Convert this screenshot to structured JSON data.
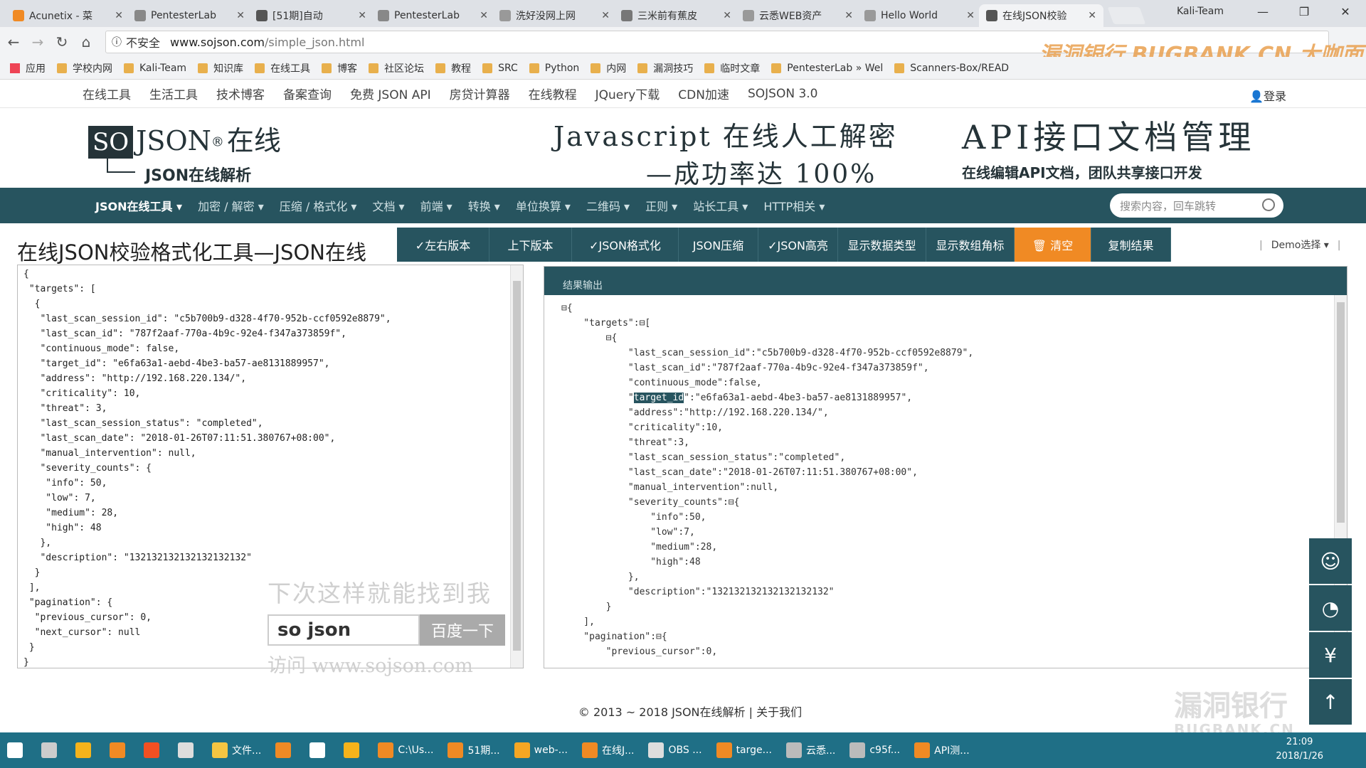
{
  "browser": {
    "tabs": [
      {
        "title": "Acunetix - 菜",
        "color": "#f08a24"
      },
      {
        "title": "PentesterLab",
        "color": "#888888"
      },
      {
        "title": "[51期]自动",
        "color": "#555555"
      },
      {
        "title": "PentesterLab",
        "color": "#888888"
      },
      {
        "title": "洗好没网上网",
        "color": "#999999"
      },
      {
        "title": "三米前有蕉皮",
        "color": "#777777"
      },
      {
        "title": "云悉WEB资产",
        "color": "#999999"
      },
      {
        "title": "Hello World",
        "color": "#999999"
      },
      {
        "title": "在线JSON校验",
        "color": "#555555"
      }
    ],
    "profile": "Kali-Team",
    "address": {
      "security": "不安全",
      "url_host": "www.sojson.com",
      "url_path": "/simple_json.html"
    },
    "bookmarks": [
      "应用",
      "学校内网",
      "Kali-Team",
      "知识库",
      "在线工具",
      "博客",
      "社区论坛",
      "教程",
      "SRC",
      "Python",
      "内网",
      "漏洞技巧",
      "临时文章",
      "PentesterLab » Wel",
      "Scanners-Box/READ"
    ],
    "overlay_watermark": "漏洞银行 BUGBANK.CN 大咖面对面"
  },
  "site": {
    "topnav": [
      "在线工具",
      "生活工具",
      "技术博客",
      "备案查询",
      "免费 JSON API",
      "房贷计算器",
      "在线教程",
      "JQuery下载",
      "CDN加速",
      "SOJSON 3.0"
    ],
    "login": "登录",
    "logo_so": "SO",
    "logo_json": "JSON",
    "logo_reg": "®",
    "logo_online": "在线",
    "logo_sub": "JSON在线解析",
    "ad1_line1": "Javascript 在线人工解密",
    "ad1_line2": "—成功率达 100%",
    "ad2_line1": "API接口文档管理",
    "ad2_line2": "在线编辑API文档，团队共享接口开发",
    "mainnav": [
      "JSON在线工具 ▾",
      "加密 / 解密 ▾",
      "压缩 / 格式化 ▾",
      "文档 ▾",
      "前端 ▾",
      "转换 ▾",
      "单位换算 ▾",
      "二维码 ▾",
      "正则 ▾",
      "站长工具 ▾",
      "HTTP相关 ▾"
    ],
    "search_placeholder": "搜索内容，回车跳转",
    "page_title": "在线JSON校验格式化工具—JSON在线",
    "toolbar": [
      "✓左右版本",
      "上下版本",
      "✓JSON格式化",
      "JSON压缩",
      "✓JSON高亮",
      "显示数据类型",
      "显示数组角标",
      "🗑 清空",
      "复制结果"
    ],
    "demo": "Demo选择 ▾",
    "editor_text": "{\n \"targets\": [\n  {\n   \"last_scan_session_id\": \"c5b700b9-d328-4f70-952b-ccf0592e8879\",\n   \"last_scan_id\": \"787f2aaf-770a-4b9c-92e4-f347a373859f\",\n   \"continuous_mode\": false,\n   \"target_id\": \"e6fa63a1-aebd-4be3-ba57-ae8131889957\",\n   \"address\": \"http://192.168.220.134/\",\n   \"criticality\": 10,\n   \"threat\": 3,\n   \"last_scan_session_status\": \"completed\",\n   \"last_scan_date\": \"2018-01-26T07:11:51.380767+08:00\",\n   \"manual_intervention\": null,\n   \"severity_counts\": {\n    \"info\": 50,\n    \"low\": 7,\n    \"medium\": 28,\n    \"high\": 48\n   },\n   \"description\": \"132132132132132132132\"\n  }\n ],\n \"pagination\": {\n  \"previous_cursor\": 0,\n  \"next_cursor\": null\n }\n}",
    "search_ad": {
      "line1": "下次这样就能找到我",
      "input": "so json",
      "button": "百度一下",
      "line3": "访问 www.sojson.com"
    },
    "result_header": "结果输出",
    "result_lines": [
      "⊟{",
      "    \"targets\":⊟[",
      "        ⊟{",
      "            \"last_scan_session_id\":\"c5b700b9-d328-4f70-952b-ccf0592e8879\",",
      "            \"last_scan_id\":\"787f2aaf-770a-4b9c-92e4-f347a373859f\",",
      "            \"continuous_mode\":false,",
      "            \"target_id\":\"e6fa63a1-aebd-4be3-ba57-ae8131889957\",",
      "            \"address\":\"http://192.168.220.134/\",",
      "            \"criticality\":10,",
      "            \"threat\":3,",
      "            \"last_scan_session_status\":\"completed\",",
      "            \"last_scan_date\":\"2018-01-26T07:11:51.380767+08:00\",",
      "            \"manual_intervention\":null,",
      "            \"severity_counts\":⊟{",
      "                \"info\":50,",
      "                \"low\":7,",
      "                \"medium\":28,",
      "                \"high\":48",
      "            },",
      "            \"description\":\"132132132132132132132\"",
      "        }",
      "    ],",
      "    \"pagination\":⊟{",
      "        \"previous_cursor\":0,"
    ],
    "footer": "© 2013 ~ 2018 JSON在线解析 | 关于我们"
  },
  "side_buttons": [
    "☺",
    "◔",
    "¥",
    "↑"
  ],
  "bugbank_wm": {
    "main": "漏洞银行",
    "sub": "BUGBANK.CN"
  },
  "taskbar": {
    "items": [
      {
        "label": "",
        "color": "#ffffff"
      },
      {
        "label": "",
        "color": "#cccccc"
      },
      {
        "label": "",
        "color": "#f5b31b"
      },
      {
        "label": "",
        "color": "#f08a24"
      },
      {
        "label": "",
        "color": "#f25022"
      },
      {
        "label": "",
        "color": "#dddddd"
      },
      {
        "label": "文件...",
        "color": "#f5c542"
      },
      {
        "label": "",
        "color": "#f08a24"
      },
      {
        "label": "",
        "color": "#ffffff"
      },
      {
        "label": "",
        "color": "#f5b31b"
      },
      {
        "label": "C:\\Us...",
        "color": "#f08a24"
      },
      {
        "label": "51期...",
        "color": "#f08a24"
      },
      {
        "label": "web-...",
        "color": "#f5a623"
      },
      {
        "label": "在线J...",
        "color": "#f08a24"
      },
      {
        "label": "OBS ...",
        "color": "#dddddd"
      },
      {
        "label": "targe...",
        "color": "#f08a24"
      },
      {
        "label": "云悉...",
        "color": "#bbbbbb"
      },
      {
        "label": "c95f...",
        "color": "#bbbbbb"
      },
      {
        "label": "API测...",
        "color": "#f08a24"
      }
    ],
    "time": "21:09",
    "date": "2018/1/26"
  }
}
